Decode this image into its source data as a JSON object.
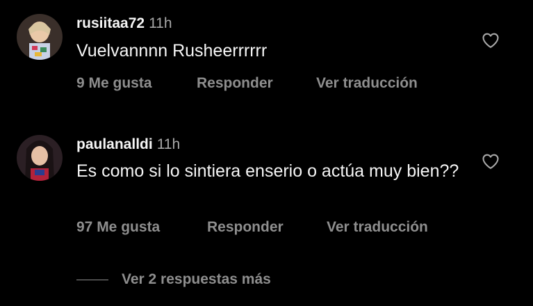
{
  "comments": [
    {
      "username": "rusiitaa72",
      "time": "11h",
      "text": "Vuelvannnn Rusheerrrrrr",
      "likes": "9 Me gusta",
      "reply": "Responder",
      "translate": "Ver traducción"
    },
    {
      "username": "paulanalldi",
      "time": "11h",
      "text": "Es como si lo sintiera enserio o actúa muy bien??",
      "likes": "97 Me gusta",
      "reply": "Responder",
      "translate": "Ver traducción"
    }
  ],
  "view_replies": "Ver 2 respuestas más",
  "colors": {
    "background": "#000000",
    "primary_text": "#f5f5f5",
    "secondary_text": "#8e8e8e"
  }
}
